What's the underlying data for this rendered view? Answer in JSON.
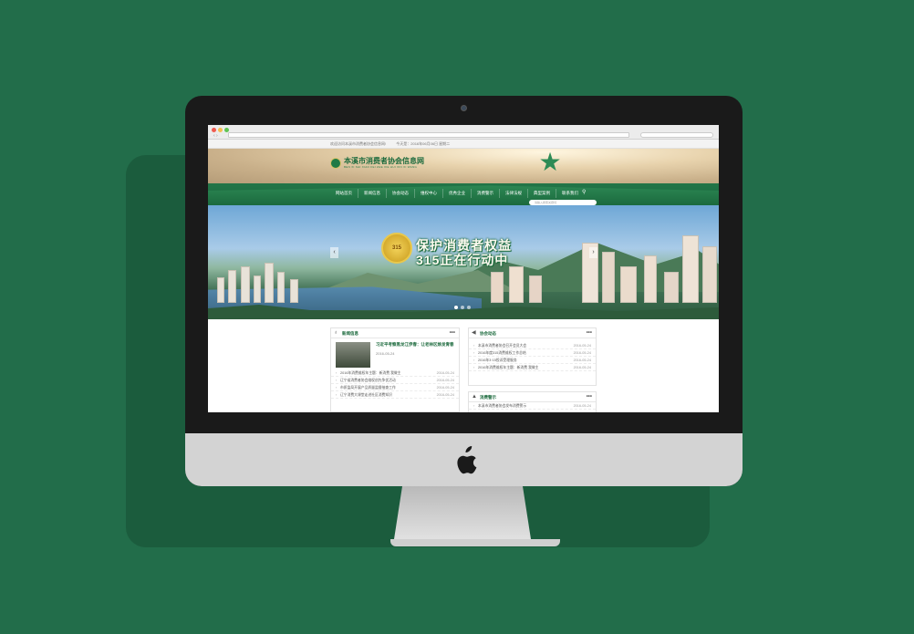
{
  "site": {
    "topbar": [
      "欢迎访问本溪市消费者协会信息网!",
      "今天是：2016年06月06日 星期二"
    ],
    "logo_cn": "本溪市消费者协会信息网",
    "logo_pinyin": "BEN XI SHI XIAO FEI ZHE XIE HUI XIN XI WANG",
    "nav": [
      "网站首页",
      "新闻信息",
      "协会动态",
      "维权中心",
      "优秀企业",
      "消费警示",
      "法律法规",
      "典型案例",
      "联系我们"
    ],
    "search_placeholder": "请输入搜索关键词"
  },
  "banner": {
    "badge": "315",
    "slogan_line1": "保护消费者权益",
    "slogan_line2": "315正在行动中",
    "prev": "‹",
    "next": "›"
  },
  "news": {
    "title": "新闻信息",
    "more": "•••",
    "feature_title": "习近平考察黑龙江伊春：让老林区焕发青春",
    "feature_date": "2016-05-24",
    "rows": [
      {
        "title": "2016年消费维权年主题：新消费 我做主",
        "date": "2016-05-24"
      },
      {
        "title": "辽宁省消费者协会维权创先争优活动",
        "date": "2016-05-24"
      },
      {
        "title": "市质监局开展产品质量监督抽查工作",
        "date": "2016-05-24"
      },
      {
        "title": "辽宁消费大课堂走进社区消费知识",
        "date": "2016-05-24"
      }
    ]
  },
  "assoc": {
    "title": "协会动态",
    "more": "•••",
    "rows": [
      {
        "title": "本溪市消费者协会召开会员大会",
        "date": "2016-05-24"
      },
      {
        "title": "2016年度315消费维权工作总结",
        "date": "2016-05-24"
      },
      {
        "title": "2016年3·15投诉受理服务",
        "date": "2016-05-24"
      },
      {
        "title": "2016年消费维权年主题：新消费 我做主",
        "date": "2016-05-24"
      }
    ]
  },
  "warn": {
    "title": "消费警示",
    "more": "•••",
    "rows": [
      {
        "title": "本溪市消费者协会发布消费警示",
        "date": "2016-05-24"
      }
    ]
  }
}
